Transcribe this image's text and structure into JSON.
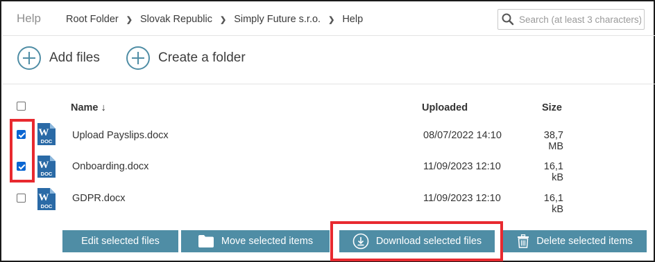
{
  "header": {
    "title": "Help",
    "breadcrumb": [
      "Root Folder",
      "Slovak Republic",
      "Simply Future s.r.o.",
      "Help"
    ],
    "search_placeholder": "Search (at least 3 characters)"
  },
  "toolbar": {
    "add_files": "Add files",
    "create_folder": "Create a folder"
  },
  "table": {
    "columns": {
      "name": "Name ↓",
      "uploaded": "Uploaded",
      "size": "Size"
    },
    "select_all_checked": false,
    "rows": [
      {
        "name": "Upload Payslips.docx",
        "uploaded": "08/07/2022 14:10",
        "size": "38,7 MB",
        "checked": true,
        "icon": "word-doc-icon",
        "icon_text": "DOC"
      },
      {
        "name": "Onboarding.docx",
        "uploaded": "11/09/2023 12:10",
        "size": "16,1 kB",
        "checked": true,
        "icon": "word-doc-icon",
        "icon_text": "DOC"
      },
      {
        "name": "GDPR.docx",
        "uploaded": "11/09/2023 12:10",
        "size": "16,1 kB",
        "checked": false,
        "icon": "word-doc-icon",
        "icon_text": "DOC"
      }
    ]
  },
  "actions": {
    "edit": "Edit selected files",
    "move": "Move selected items",
    "download": "Download selected files",
    "delete": "Delete selected items"
  },
  "colors": {
    "accent": "#4f8da5",
    "highlight": "#e8292f",
    "checkbox": "#0a66d2",
    "doc_icon": "#2a6aa6"
  }
}
